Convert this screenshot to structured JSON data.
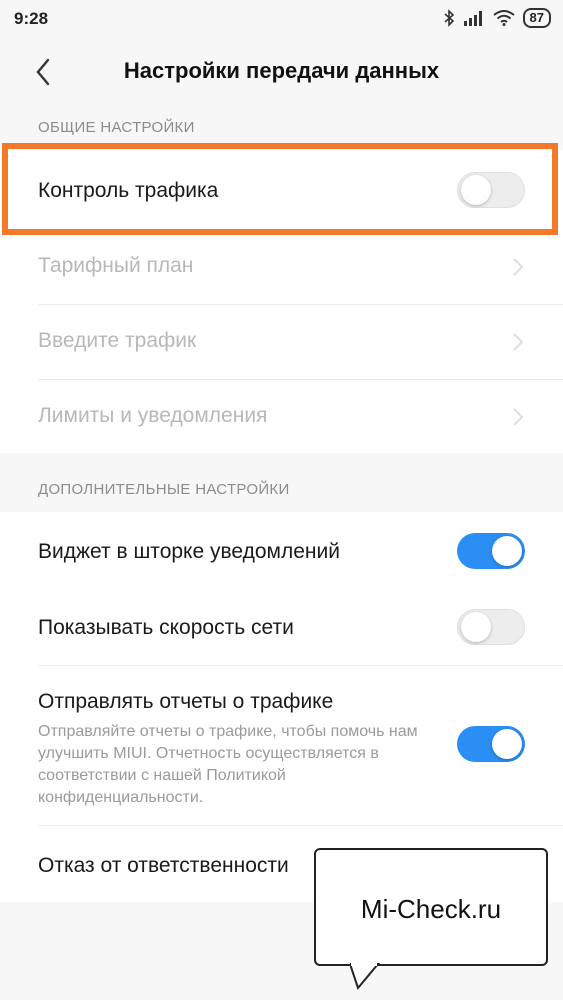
{
  "status_bar": {
    "time": "9:28",
    "battery": "87"
  },
  "header": {
    "title": "Настройки передачи данных"
  },
  "general": {
    "section_title": "ОБЩИЕ НАСТРОЙКИ",
    "traffic_control": {
      "label": "Контроль трафика",
      "enabled": false
    },
    "tariff_plan": {
      "label": "Тарифный план"
    },
    "enter_traffic": {
      "label": "Введите трафик"
    },
    "limits": {
      "label": "Лимиты и уведомления"
    }
  },
  "additional": {
    "section_title": "ДОПОЛНИТЕЛЬНЫЕ НАСТРОЙКИ",
    "widget": {
      "label": "Виджет в шторке уведомлений",
      "enabled": true
    },
    "speed": {
      "label": "Показывать скорость сети",
      "enabled": false
    },
    "reports": {
      "label": "Отправлять отчеты о трафике",
      "description": "Отправляйте отчеты о трафике, чтобы помочь нам улучшить MIUI. Отчетность осуществляется в соответствии с нашей Политикой конфиденциальности.",
      "enabled": true
    },
    "disclaimer": {
      "label": "Отказ от ответственности"
    }
  },
  "watermark": {
    "text": "Mi-Check.ru"
  },
  "colors": {
    "accent": "#2b8ef4",
    "highlight": "#f47a2a"
  }
}
